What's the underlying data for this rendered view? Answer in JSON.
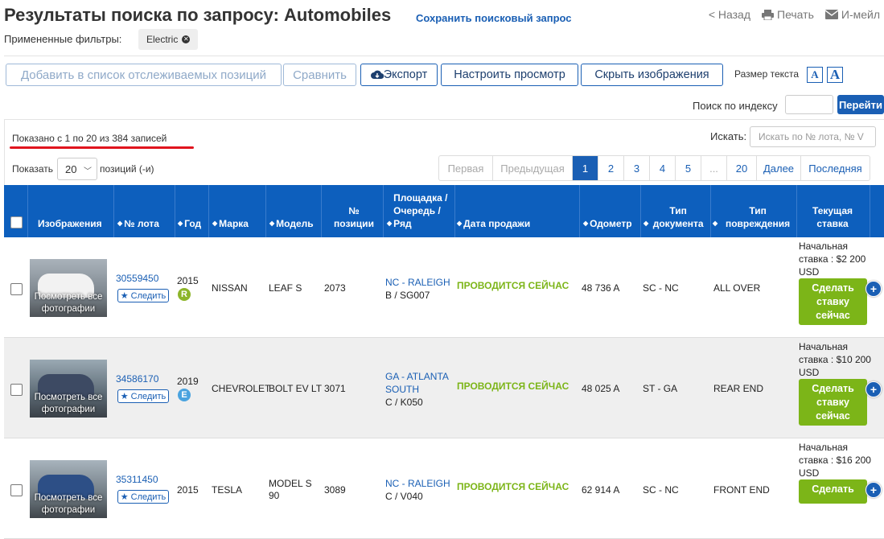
{
  "header": {
    "title": "Результаты поиска по запросу: Automobiles",
    "save_query": "Сохранить поисковый запрос",
    "back": "< Назад",
    "print": "Печать",
    "email": "И-мейл",
    "filters_label": "Примененные фильтры:",
    "filter_chip": "Electric"
  },
  "toolbar": {
    "watchlist": "Добавить в список отслеживаемых позиций",
    "compare": "Сравнить",
    "export": "Экспорт",
    "customize": "Настроить просмотр",
    "hide_images": "Скрыть изображения",
    "text_size_label": "Размер текста",
    "text_small": "A",
    "text_large": "A",
    "index_search_label": "Поиск по индексу",
    "go": "Перейти"
  },
  "listing": {
    "shown_text": "Показано с 1 по 20 из 384 записей",
    "search_label": "Искать:",
    "search_placeholder": "Искать по № лота, № V",
    "show_label": "Показать",
    "page_size": "20",
    "show_suffix": "позиций (-и)",
    "pagination": [
      "Первая",
      "Предыдущая",
      "1",
      "2",
      "3",
      "4",
      "5",
      "...",
      "20",
      "Далее",
      "Последняя"
    ],
    "active_page": "1"
  },
  "table": {
    "columns": [
      "Изображения",
      "№ лота",
      "Год",
      "Марка",
      "Модель",
      "№ позиции",
      "Площадка / Очередь / Ряд",
      "Дата продажи",
      "Одометр",
      "Тип документа",
      "Тип повреждения",
      "Текущая ставка"
    ],
    "see_all_photos": "Посмотреть все фотографии",
    "follow": "Следить",
    "rows": [
      {
        "lot": "30559450",
        "year": "2015",
        "badge": "R",
        "make": "NISSAN",
        "model": "LEAF S",
        "item": "2073",
        "location": "NC - RALEIGH",
        "lane": "B / SG007",
        "sale": "ПРОВОДИТСЯ СЕЙЧАС",
        "odometer": "48 736 A",
        "doc": "SC - NC",
        "damage": "ALL OVER",
        "bid": "Начальная ставка : $2 200 USD",
        "bid_btn": "Сделать ставку сейчас"
      },
      {
        "lot": "34586170",
        "year": "2019",
        "badge": "E",
        "make": "CHEVROLET",
        "model": "BOLT EV LT",
        "item": "3071",
        "location": "GA - ATLANTA SOUTH",
        "lane": "C / K050",
        "sale": "ПРОВОДИТСЯ СЕЙЧАС",
        "odometer": "48 025 A",
        "doc": "ST - GA",
        "damage": "REAR END",
        "bid": "Начальная ставка : $10 200 USD",
        "bid_btn": "Сделать ставку сейчас"
      },
      {
        "lot": "35311450",
        "year": "2015",
        "badge": "",
        "make": "TESLA",
        "model": "MODEL S 90",
        "item": "3089",
        "location": "NC - RALEIGH",
        "lane": "C / V040",
        "sale": "ПРОВОДИТСЯ СЕЙЧАС",
        "odometer": "62 914 A",
        "doc": "SC - NC",
        "damage": "FRONT END",
        "bid": "Начальная ставка : $16 200 USD",
        "bid_btn": "Сделать"
      }
    ]
  },
  "colors": {
    "accent": "#0d5fbd",
    "live": "#7cb518",
    "badge_r": "#8db52a",
    "badge_e": "#4aa3df",
    "underline": "#e0141e"
  }
}
